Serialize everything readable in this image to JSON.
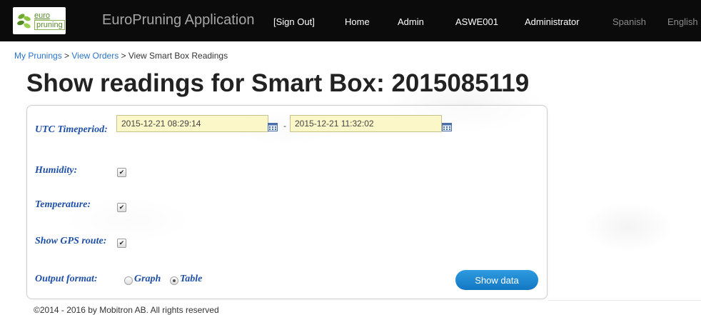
{
  "header": {
    "logo": {
      "line1": "euro",
      "line2": "pruning"
    },
    "app_title": "EuroPruning Application",
    "nav": {
      "sign_out": "[Sign Out]",
      "home": "Home",
      "admin": "Admin",
      "user_id": "ASWE001",
      "role": "Administrator",
      "spanish": "Spanish",
      "english": "English"
    }
  },
  "breadcrumb": {
    "my_prunings": "My Prunings",
    "separator": " > ",
    "view_orders": "View Orders",
    "current": "View Smart Box Readings"
  },
  "page_title": "Show readings for Smart Box: 2015085119",
  "form": {
    "timeperiod_label": "UTC Timeperiod:",
    "start_value": "2015-12-21 08:29:14",
    "range_dash": "-",
    "end_value": "2015-12-21 11:32:02",
    "humidity_label": "Humidity:",
    "humidity_checked": true,
    "temperature_label": "Temperature:",
    "temperature_checked": true,
    "gps_label": "Show GPS route:",
    "gps_checked": true,
    "output_label": "Output format:",
    "output_options": [
      "Graph",
      "Table"
    ],
    "output_selected": "Table",
    "submit_label": "Show data"
  },
  "footer": "©2014 - 2016 by Mobitron AB. All rights reserved",
  "colors": {
    "label": "#1f4fa6",
    "input_bg": "#fbf7c8",
    "button": "#1a85d0",
    "link": "#2a72c9"
  }
}
